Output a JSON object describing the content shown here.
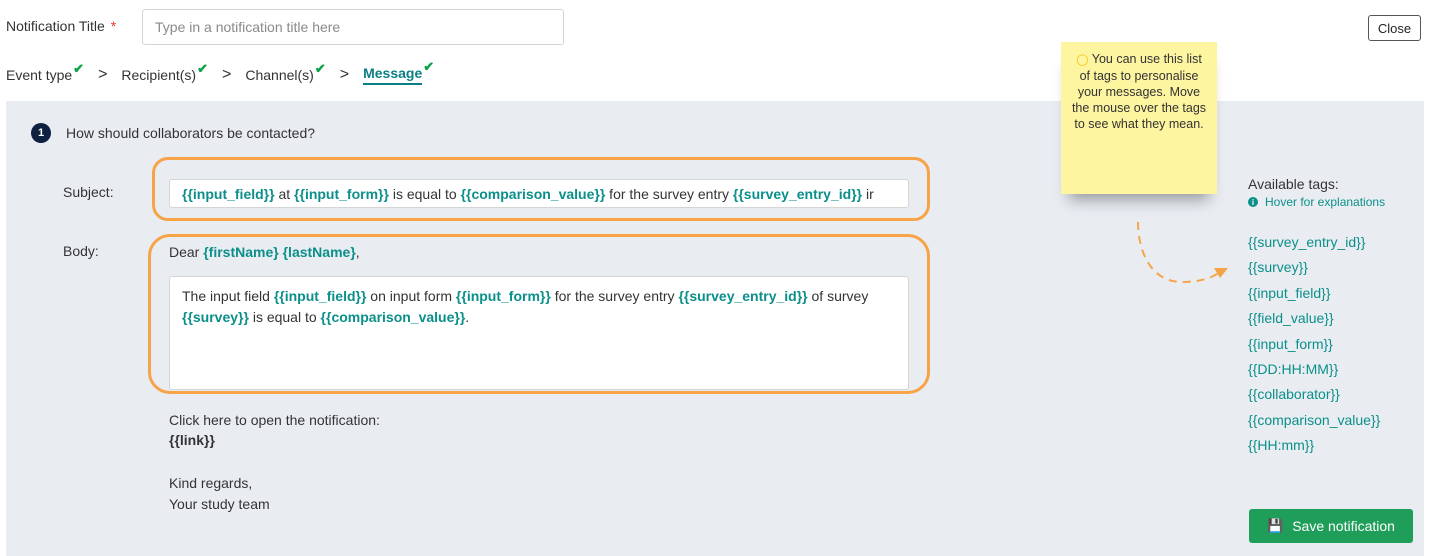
{
  "header": {
    "title_label": "Notification Title",
    "required_mark": "*",
    "title_placeholder": "Type in a notification title here",
    "title_value": "",
    "close_label": "Close"
  },
  "steps": [
    {
      "label": "Event type",
      "done": true
    },
    {
      "label": "Recipient(s)",
      "done": true
    },
    {
      "label": "Channel(s)",
      "done": true
    },
    {
      "label": "Message",
      "done": true,
      "active": true
    }
  ],
  "step_separator": ">",
  "step_check": "✔",
  "question": {
    "number": "1",
    "text": "How should collaborators be contacted?"
  },
  "form": {
    "subject_label": "Subject:",
    "body_label": "Body:",
    "subject_parts": [
      {
        "t": "{{input_field}}",
        "tag": true
      },
      {
        "t": " at ",
        "tag": false
      },
      {
        "t": "{{input_form}}",
        "tag": true
      },
      {
        "t": " is equal to ",
        "tag": false
      },
      {
        "t": "{{comparison_value}}",
        "tag": true
      },
      {
        "t": " for the survey entry ",
        "tag": false
      },
      {
        "t": "{{survey_entry_id}}",
        "tag": true
      },
      {
        "t": " ir",
        "tag": false
      }
    ],
    "greeting": {
      "prefix": "Dear ",
      "first": "{firstName}",
      "last": "{lastName}",
      "suffix": ","
    },
    "body_parts": [
      {
        "t": "The input field ",
        "tag": false
      },
      {
        "t": "{{input_field}}",
        "tag": true
      },
      {
        "t": " on input form ",
        "tag": false
      },
      {
        "t": "{{input_form}}",
        "tag": true
      },
      {
        "t": " for the survey entry ",
        "tag": false
      },
      {
        "t": "{{survey_entry_id}}",
        "tag": true
      },
      {
        "t": " of survey ",
        "tag": false
      },
      {
        "t": "{{survey}}",
        "tag": true
      },
      {
        "t": " is equal to ",
        "tag": false
      },
      {
        "t": "{{comparison_value}}",
        "tag": true
      },
      {
        "t": ".",
        "tag": false
      }
    ],
    "open_text": "Click here to open the notification:",
    "link_tag": "{{link}}",
    "regards": "Kind regards,",
    "team": "Your study team"
  },
  "tip": {
    "icon": "lightbulb-icon",
    "text": "You can use this list of tags to personalise your messages. Move the mouse over the tags to see what they mean."
  },
  "tags_panel": {
    "title": "Available tags:",
    "hover_text": "Hover for explanations",
    "info_icon": "info-icon",
    "tags": [
      "{{survey_entry_id}}",
      "{{survey}}",
      "{{input_field}}",
      "{{field_value}}",
      "{{input_form}}",
      "{{DD:HH:MM}}",
      "{{collaborator}}",
      "{{comparison_value}}",
      "{{HH:mm}}"
    ]
  },
  "save_button": {
    "label": "Save notification",
    "icon": "floppy-disk-icon"
  },
  "colors": {
    "accent": "#0b8f8a",
    "highlight": "#f7a347",
    "save": "#1f9e5a",
    "panel_bg": "#e9edf2",
    "tip_bg": "#fdf5a0",
    "check": "#0ea34a"
  }
}
